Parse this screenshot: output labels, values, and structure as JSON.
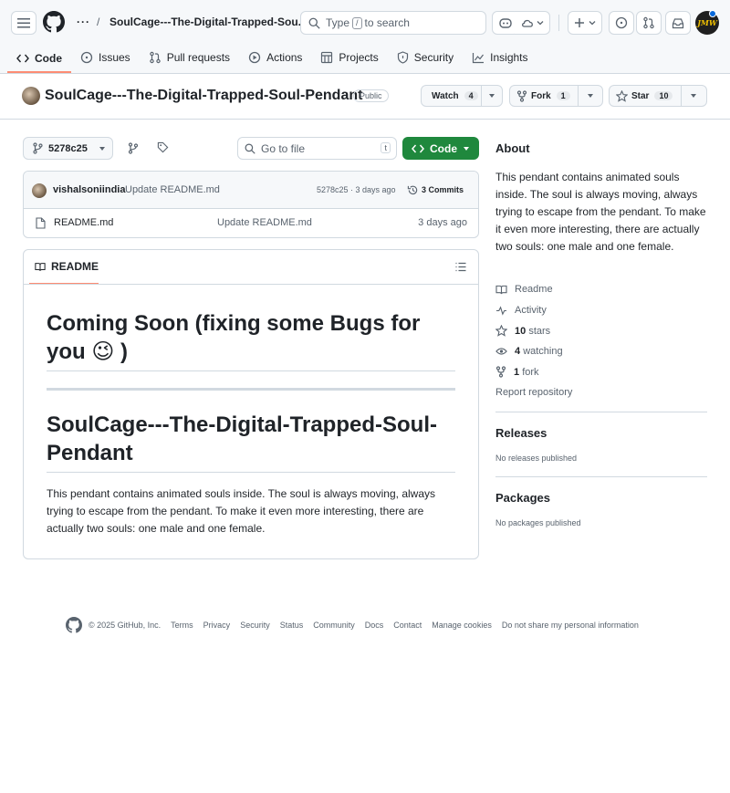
{
  "header": {
    "breadcrumb_sep": "/",
    "repo_crumb": "SoulCage---The-Digital-Trapped-Sou...",
    "search_prefix": "Type",
    "search_key": "/",
    "search_suffix": "to search",
    "avatar_text": "JMW"
  },
  "tabs": [
    {
      "label": "Code",
      "icon": "code-icon",
      "active": true
    },
    {
      "label": "Issues",
      "icon": "issue-icon"
    },
    {
      "label": "Pull requests",
      "icon": "pull-request-icon"
    },
    {
      "label": "Actions",
      "icon": "play-icon"
    },
    {
      "label": "Projects",
      "icon": "table-icon"
    },
    {
      "label": "Security",
      "icon": "shield-icon"
    },
    {
      "label": "Insights",
      "icon": "graph-icon"
    }
  ],
  "repo": {
    "title": "SoulCage---The-Digital-Trapped-Soul-Pendant",
    "visibility": "Public",
    "watch_label": "Watch",
    "watch_count": "4",
    "fork_label": "Fork",
    "fork_count": "1",
    "star_label": "Star",
    "star_count": "10"
  },
  "toolbar": {
    "branch": "5278c25",
    "goto_placeholder": "Go to file",
    "goto_key": "t",
    "code_label": "Code"
  },
  "commit": {
    "author": "vishalsoniindia",
    "message": "Update README.md",
    "hash_time": "5278c25 · 3 days ago",
    "commits_label": "3 Commits"
  },
  "files": [
    {
      "name": "README.md",
      "message": "Update README.md",
      "time": "3 days ago"
    }
  ],
  "readme": {
    "tab_label": "README",
    "heading1": "Coming Soon (fixing some Bugs for you 😉 )",
    "heading2": "SoulCage---The-Digital-Trapped-Soul-Pendant",
    "paragraph": "This pendant contains animated souls inside. The soul is always moving, always trying to escape from the pendant. To make it even more interesting, there are actually two souls: one male and one female."
  },
  "about": {
    "title": "About",
    "description": "This pendant contains animated souls inside. The soul is always moving, always trying to escape from the pendant. To make it even more interesting, there are actually two souls: one male and one female.",
    "readme_label": "Readme",
    "activity_label": "Activity",
    "stars_count": "10",
    "stars_label": "stars",
    "watching_count": "4",
    "watching_label": "watching",
    "fork_count": "1",
    "fork_label": "fork",
    "report_label": "Report repository"
  },
  "releases": {
    "title": "Releases",
    "empty": "No releases published"
  },
  "packages": {
    "title": "Packages",
    "empty": "No packages published"
  },
  "footer": {
    "copyright": "© 2025 GitHub, Inc.",
    "links": [
      "Terms",
      "Privacy",
      "Security",
      "Status",
      "Community",
      "Docs",
      "Contact",
      "Manage cookies",
      "Do not share my personal information"
    ]
  },
  "colors": {
    "accent_green": "#1f883d",
    "tab_underline": "#fd8c73",
    "notification_dot": "#0969da"
  }
}
